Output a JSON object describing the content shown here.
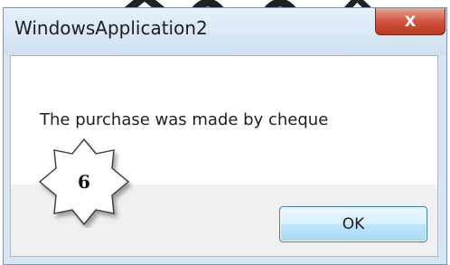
{
  "window": {
    "title": "WindowsApplication2",
    "close_glyph": "X"
  },
  "message": {
    "text": "The purchase was made by cheque"
  },
  "buttons": {
    "ok_label": "OK"
  },
  "badge": {
    "number": "6"
  },
  "icons": {
    "close": "close-icon",
    "badge": "star-icon"
  },
  "colors": {
    "close_button": "#c94a33",
    "ok_button_border": "#3c7fb1",
    "titlebar": "#d7e6f5"
  }
}
